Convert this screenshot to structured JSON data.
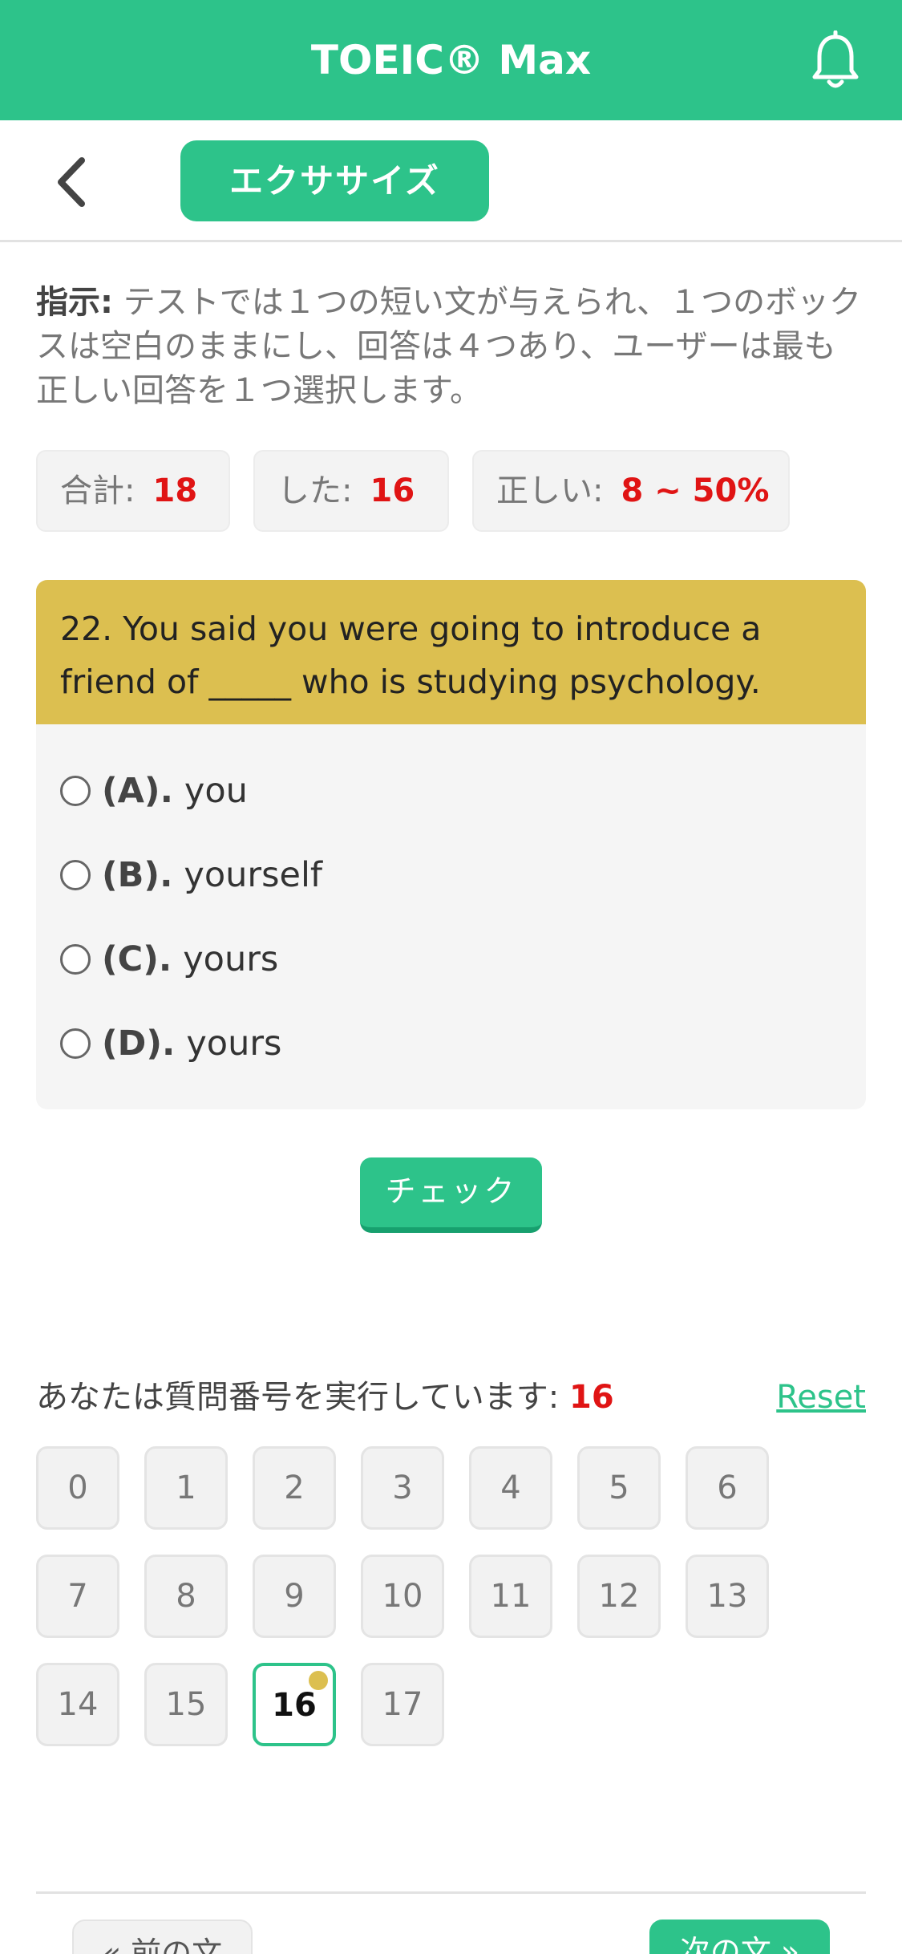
{
  "header": {
    "title": "TOEIC® Max",
    "notification_icon": "bell-icon"
  },
  "subheader": {
    "back_icon": "chevron-left-icon",
    "tab_label": "エクササイズ"
  },
  "instructions": {
    "label": "指示:",
    "text": " テストでは１つの短い文が与えられ、１つのボックスは空白のままにし、回答は４つあり、ユーザーは最も正しい回答を１つ選択します。"
  },
  "stats": [
    {
      "label": "合計:",
      "value": "18"
    },
    {
      "label": "した:",
      "value": "16"
    },
    {
      "label": "正しい:",
      "value": "8 ~ 50%"
    }
  ],
  "question": {
    "text": "22. You said you were going to introduce a friend of _____ who is studying psychology.",
    "options": [
      {
        "letter": "(A).",
        "text": "you"
      },
      {
        "letter": "(B).",
        "text": "yourself"
      },
      {
        "letter": "(C).",
        "text": "yours"
      },
      {
        "letter": "(D).",
        "text": "yours"
      }
    ]
  },
  "check_label": "チェック",
  "progress": {
    "label": "あなたは質問番号を実行しています:",
    "value": "16",
    "reset_label": "Reset"
  },
  "numbers": [
    "0",
    "1",
    "2",
    "3",
    "4",
    "5",
    "6",
    "7",
    "8",
    "9",
    "10",
    "11",
    "12",
    "13",
    "14",
    "15",
    "16",
    "17"
  ],
  "current_number": "16",
  "nav": {
    "prev_label": "« 前の文",
    "next_label": "次の文 »"
  },
  "colors": {
    "primary": "#2dc38a",
    "question_bg": "#dcbf50",
    "highlight": "#e01414"
  }
}
